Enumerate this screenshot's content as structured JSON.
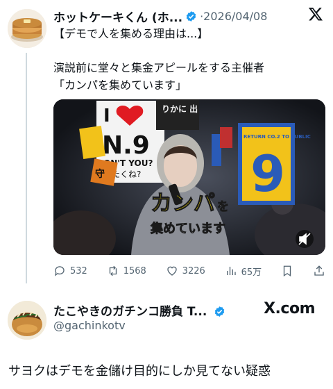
{
  "post1": {
    "display_name": "ホットケーキくん (ホ...",
    "date": "·2026/04/08",
    "line1": "【デモで人を集める理由は...】",
    "line2": "演説前に堂々と集金アピールをする主催者",
    "line3": "「カンパを集めています」",
    "media": {
      "caption_main": "カンパ",
      "caption_particle": "を",
      "caption_line2": "集めています",
      "sign_heart_text": "I",
      "sign_n9": "N.9",
      "sign_small": "ON'T YOU?",
      "sign_small2": "たくね?",
      "sign_side": "守",
      "sign_top_right": "りかに\n出",
      "sign_number": "9",
      "sign_blue_text": "RETURN CO.2 TO PUBLIC"
    },
    "stats": {
      "replies": "532",
      "reposts": "1568",
      "likes": "3226",
      "views": "65万"
    }
  },
  "post2": {
    "display_name": "たこやきのガチンコ勝負 T...",
    "handle": "@gachinkotv",
    "brand": "X.com",
    "body": "サヨクはデモを金儲け目的にしか見てない疑惑"
  },
  "colors": {
    "verified": "#1d9bf0",
    "caption_yellow": "#ffe600",
    "sign_blue": "#2a5bb8",
    "sign_yellow": "#f2c21a",
    "text_secondary": "#536471"
  },
  "icons": [
    "x-logo-icon",
    "verified-badge-icon",
    "reply-icon",
    "repost-icon",
    "like-icon",
    "views-icon",
    "bookmark-icon",
    "share-icon",
    "mute-icon"
  ]
}
